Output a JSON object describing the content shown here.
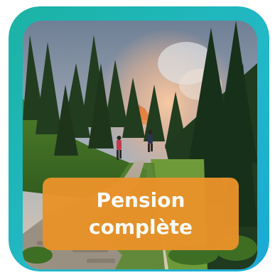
{
  "tile": {
    "label_line_1": "Pension",
    "label_line_2": "complète",
    "border_color": "#1fb6b8",
    "label_color": "#e9922a",
    "photo_subject": "hikers-on-mountain-trail-photo"
  }
}
